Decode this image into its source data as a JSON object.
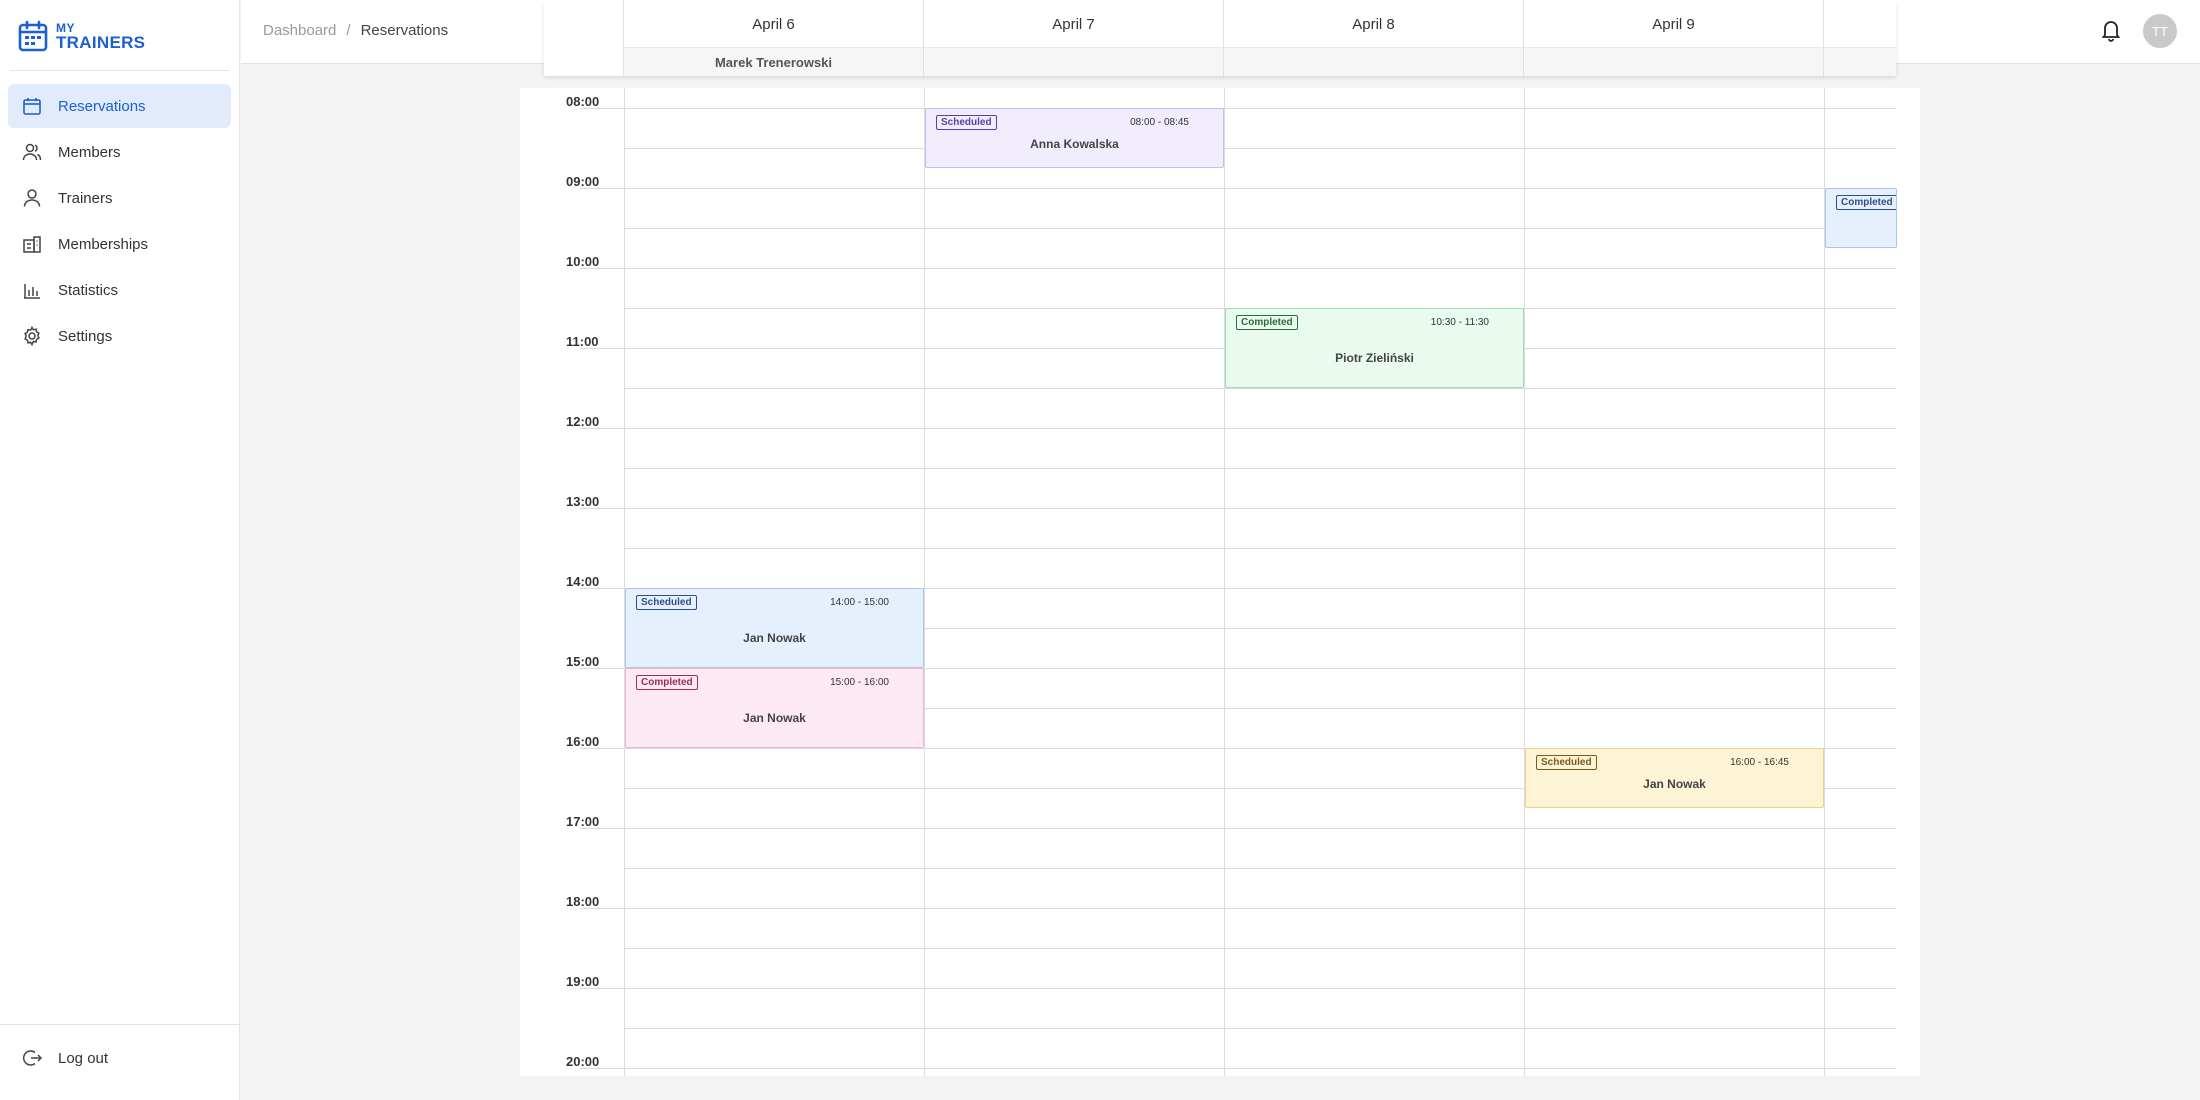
{
  "app": {
    "logo_my": "MY",
    "logo_trainers": "TRAINERS"
  },
  "sidebar": {
    "items": [
      {
        "label": "Reservations",
        "icon": "calendar-icon",
        "active": true
      },
      {
        "label": "Members",
        "icon": "members-icon"
      },
      {
        "label": "Trainers",
        "icon": "user-icon"
      },
      {
        "label": "Memberships",
        "icon": "memberships-icon"
      },
      {
        "label": "Statistics",
        "icon": "chart-icon"
      },
      {
        "label": "Settings",
        "icon": "gear-icon"
      }
    ],
    "logout_label": "Log out"
  },
  "header": {
    "breadcrumb": [
      "Dashboard",
      "Reservations"
    ],
    "avatar_initials": "TT"
  },
  "calendar": {
    "days": [
      "April 6",
      "April 7",
      "April 8",
      "April 9",
      ""
    ],
    "trainer": "Marek Trenerowski",
    "hours": [
      "08:00",
      "09:00",
      "10:00",
      "11:00",
      "12:00",
      "13:00",
      "14:00",
      "15:00",
      "16:00",
      "17:00",
      "18:00",
      "19:00",
      "20:00"
    ],
    "events": [
      {
        "day": 1,
        "status": "Scheduled",
        "time": "08:00 - 08:45",
        "member": "Anna Kowalska",
        "start": "08:00",
        "end": "08:45",
        "color": "purple"
      },
      {
        "day": 2,
        "status": "Completed",
        "time": "10:30 - 11:30",
        "member": "Piotr Zieliński",
        "start": "10:30",
        "end": "11:30",
        "color": "green"
      },
      {
        "day": 0,
        "status": "Scheduled",
        "time": "14:00 - 15:00",
        "member": "Jan Nowak",
        "start": "14:00",
        "end": "15:00",
        "color": "blue"
      },
      {
        "day": 0,
        "status": "Completed",
        "time": "15:00 - 16:00",
        "member": "Jan Nowak",
        "start": "15:00",
        "end": "16:00",
        "color": "pink"
      },
      {
        "day": 3,
        "status": "Scheduled",
        "time": "16:00 - 16:45",
        "member": "Jan Nowak",
        "start": "16:00",
        "end": "16:45",
        "color": "yellow"
      },
      {
        "day": 4,
        "status": "Completed",
        "time": "",
        "member": "",
        "start": "09:00",
        "end": "09:45",
        "color": "blue"
      }
    ]
  },
  "colors": {
    "accent": "#1a5fd6",
    "purple": {
      "bg": "#f1edfd",
      "border": "#c9bdf0",
      "badge": "#5b3fa6"
    },
    "green": {
      "bg": "#e8fbee",
      "border": "#9fdcb0",
      "badge": "#2f6b3f"
    },
    "blue": {
      "bg": "#e6f0fd",
      "border": "#a9c6ee",
      "badge": "#2f4f86"
    },
    "pink": {
      "bg": "#fde9f3",
      "border": "#f0b5cf",
      "badge": "#9a3050"
    },
    "yellow": {
      "bg": "#fdf4d6",
      "border": "#ead48c",
      "badge": "#7a5a14"
    }
  }
}
